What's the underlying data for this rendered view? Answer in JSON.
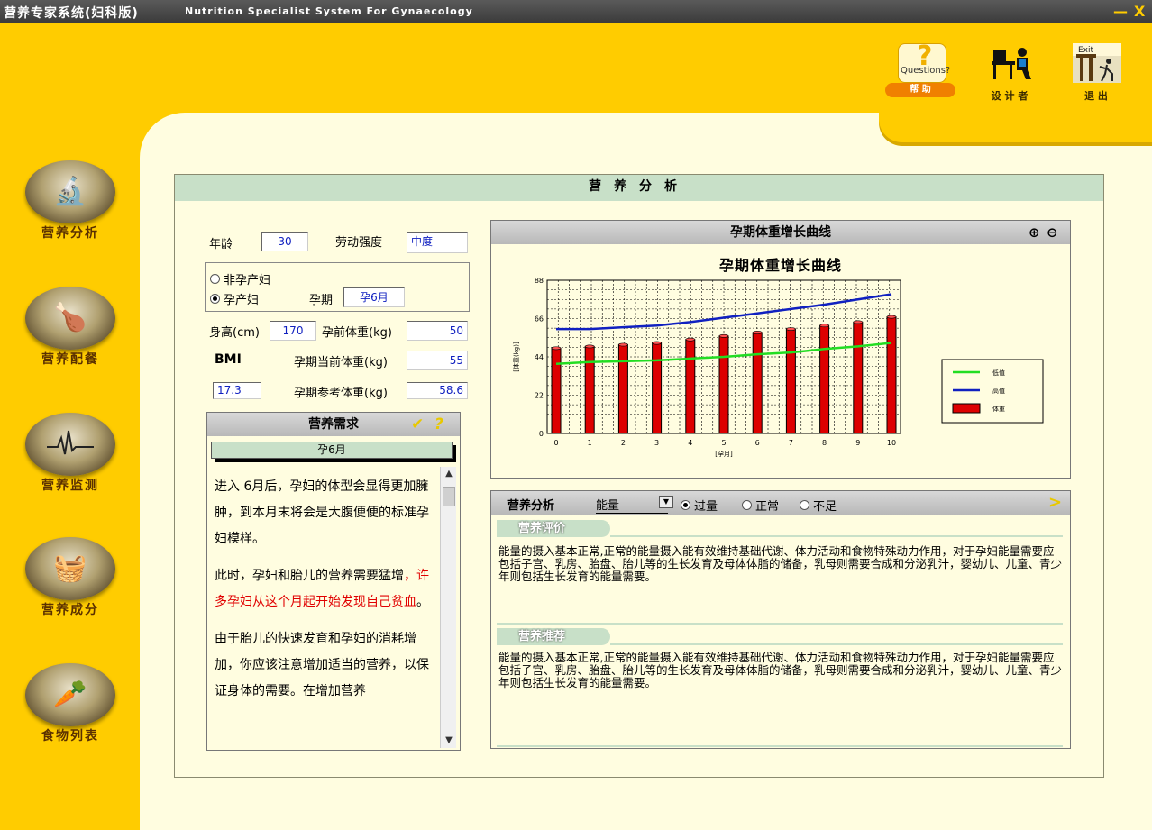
{
  "titlebar": {
    "app_name": "营养专家系统(妇科版)",
    "subtitle": "Nutrition Specialist System For Gynaecology",
    "minimize": "—",
    "close": "X"
  },
  "top_buttons": {
    "help_label": "帮 助",
    "help_q": "Questions?",
    "designer_label": "设 计 者",
    "exit_label": "退 出",
    "exit_sign": "Exit"
  },
  "nav": [
    {
      "label": "营养分析",
      "icon": "microscope-icon"
    },
    {
      "label": "营养配餐",
      "icon": "meal-icon"
    },
    {
      "label": "营养监测",
      "icon": "heartbeat-icon"
    },
    {
      "label": "营养成分",
      "icon": "ingredients-icon"
    },
    {
      "label": "食物列表",
      "icon": "food-list-icon"
    }
  ],
  "panel": {
    "title": "营养分析",
    "age_label": "年龄",
    "age": "30",
    "labor_label": "劳动强度",
    "labor": "中度",
    "non_pregnant_label": "非孕产妇",
    "pregnant_label": "孕产妇",
    "stage_label": "孕期",
    "stage": "孕6月",
    "height_label": "身高(cm)",
    "height": "170",
    "pre_weight_label": "孕前体重(kg)",
    "pre_weight": "50",
    "bmi_label": "BMI",
    "bmi": "17.3",
    "cur_weight_label": "孕期当前体重(kg)",
    "cur_weight": "55",
    "ref_weight_label": "孕期参考体重(kg)",
    "ref_weight": "58.6"
  },
  "requirement": {
    "header": "营养需求",
    "month": "孕6月",
    "p1": "进入 6月后，孕妇的体型会显得更加臃肿，到本月末将会是大腹便便的标准孕妇模样。",
    "p2a": "此时，孕妇和胎儿的营养需要猛增",
    "p2b": "，许多孕妇从这个月起开始发现自己贫血",
    "p2c": "。",
    "p3": "由于胎儿的快速发育和孕妇的消耗增加，你应该注意增加适当的营养，以保证身体的需要。在增加营养"
  },
  "chart_box": {
    "header": "孕期体重增长曲线"
  },
  "chart_data": {
    "type": "bar",
    "title": "孕期体重增长曲线",
    "xlabel": "[孕月]",
    "ylabel": "[体重(kg)]",
    "x": [
      0,
      1,
      2,
      3,
      4,
      5,
      6,
      7,
      8,
      9,
      10
    ],
    "ylim": [
      0,
      88
    ],
    "yticks": [
      0,
      22,
      44,
      66,
      88
    ],
    "grid": true,
    "legend_position": "right",
    "series": [
      {
        "name": "低值",
        "type": "line",
        "color": "#22dd22",
        "values": [
          40,
          41,
          41.5,
          42,
          43,
          44,
          45.5,
          46.5,
          48.5,
          50,
          52
        ]
      },
      {
        "name": "高值",
        "type": "line",
        "color": "#1020c0",
        "values": [
          60,
          60,
          61,
          62,
          64,
          66.5,
          69,
          71.5,
          74,
          77,
          80
        ]
      },
      {
        "name": "体重",
        "type": "bar",
        "color": "#dd0000",
        "values": [
          49,
          50,
          51,
          52,
          54,
          56,
          58,
          60,
          62,
          64,
          67
        ]
      }
    ]
  },
  "analysis": {
    "bar_title": "营养分析",
    "nutrient": "能量",
    "opt_over": "过量",
    "opt_normal": "正常",
    "opt_low": "不足",
    "eval_label": "营养评价",
    "eval_text": "能量的摄入基本正常,正常的能量摄入能有效维持基础代谢、体力活动和食物特殊动力作用，对于孕妇能量需要应包括子宫、乳房、胎盘、胎儿等的生长发育及母体体脂的储备，乳母则需要合成和分泌乳汁，婴幼儿、儿童、青少年则包括生长发育的能量需要。",
    "rec_label": "营养推荐",
    "rec_text": "能量的摄入基本正常,正常的能量摄入能有效维持基础代谢、体力活动和食物特殊动力作用，对于孕妇能量需要应包括子宫、乳房、胎盘、胎儿等的生长发育及母体体脂的储备，乳母则需要合成和分泌乳汁，婴幼儿、儿童、青少年则包括生长发育的能量需要。"
  }
}
